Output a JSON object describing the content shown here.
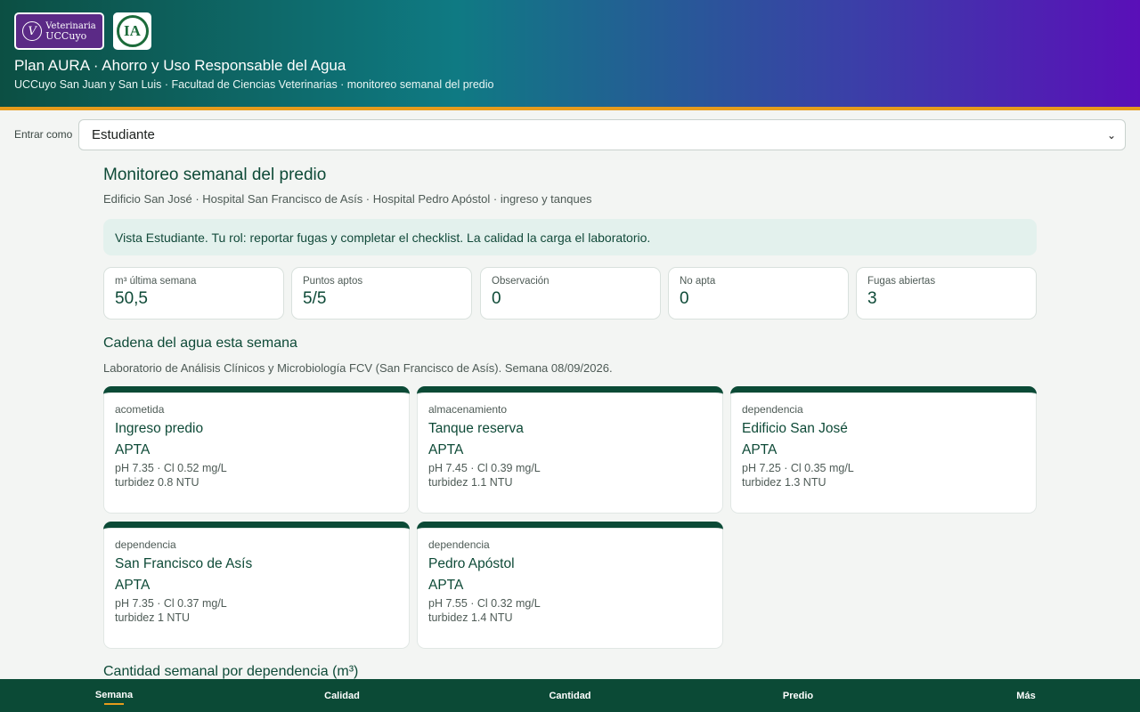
{
  "header": {
    "logo_vet_line1": "Veterinaria",
    "logo_vet_line2": "UCCuyo",
    "logo_ia_text": "IA",
    "title": "Plan AURA · Ahorro y Uso Responsable del Agua",
    "subtitle": "UCCuyo San Juan y San Luis · Facultad de Ciencias Veterinarias · monitoreo semanal del predio",
    "accent_color": "#e69b1c"
  },
  "role": {
    "label": "Entrar como",
    "selected": "Estudiante"
  },
  "main": {
    "title": "Monitoreo semanal del predio",
    "subtitle": "Edificio San José · Hospital San Francisco de Asís · Hospital Pedro Apóstol · ingreso y tanques",
    "notice": "Vista Estudiante. Tu rol: reportar fugas y completar el checklist. La calidad la carga el laboratorio.",
    "kpis": [
      {
        "label": "m³ última semana",
        "value": "50,5"
      },
      {
        "label": "Puntos aptos",
        "value": "5/5"
      },
      {
        "label": "Observación",
        "value": "0"
      },
      {
        "label": "No apta",
        "value": "0"
      },
      {
        "label": "Fugas abiertas",
        "value": "3"
      }
    ],
    "chain_title": "Cadena del agua esta semana",
    "chain_subtitle": "Laboratorio de Análisis Clínicos y Microbiología FCV (San Francisco de Asís). Semana 08/09/2026.",
    "points": [
      {
        "type": "acometida",
        "name": "Ingreso predio",
        "status": "APTA",
        "line1": "pH 7.35 · Cl 0.52 mg/L",
        "line2": "turbidez 0.8 NTU"
      },
      {
        "type": "almacenamiento",
        "name": "Tanque reserva",
        "status": "APTA",
        "line1": "pH 7.45 · Cl 0.39 mg/L",
        "line2": "turbidez 1.1 NTU"
      },
      {
        "type": "dependencia",
        "name": "Edificio San José",
        "status": "APTA",
        "line1": "pH 7.25 · Cl 0.35 mg/L",
        "line2": "turbidez 1.3 NTU"
      },
      {
        "type": "dependencia",
        "name": "San Francisco de Asís",
        "status": "APTA",
        "line1": "pH 7.35 · Cl 0.37 mg/L",
        "line2": "turbidez 1 NTU"
      },
      {
        "type": "dependencia",
        "name": "Pedro Apóstol",
        "status": "APTA",
        "line1": "pH 7.55 · Cl 0.32 mg/L",
        "line2": "turbidez 1.4 NTU"
      }
    ],
    "quantity_title": "Cantidad semanal por dependencia (m³)"
  },
  "nav": {
    "items": [
      {
        "label": "Semana",
        "active": true
      },
      {
        "label": "Calidad"
      },
      {
        "label": "Cantidad"
      },
      {
        "label": "Predio"
      },
      {
        "label": "Más"
      }
    ]
  }
}
